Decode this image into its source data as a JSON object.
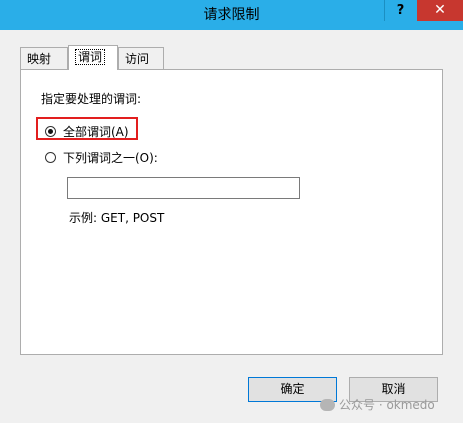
{
  "window": {
    "title": "请求限制",
    "help_glyph": "?",
    "close_glyph": "✕"
  },
  "tabs": [
    {
      "label": "映射",
      "active": false
    },
    {
      "label": "谓词",
      "active": true
    },
    {
      "label": "访问",
      "active": false
    }
  ],
  "verbs_panel": {
    "instruction": "指定要处理的谓词:",
    "option_all": "全部谓词(A)",
    "option_list": "下列谓词之一(O):",
    "selected": "全部谓词(A)",
    "list_input_value": "",
    "example": "示例: GET, POST"
  },
  "buttons": {
    "ok": "确定",
    "cancel": "取消"
  },
  "watermark": {
    "text": "公众号 · okmedo"
  },
  "colors": {
    "titlebar": "#2aaee8",
    "close_button": "#c7372f",
    "highlight": "#e21e1e"
  }
}
